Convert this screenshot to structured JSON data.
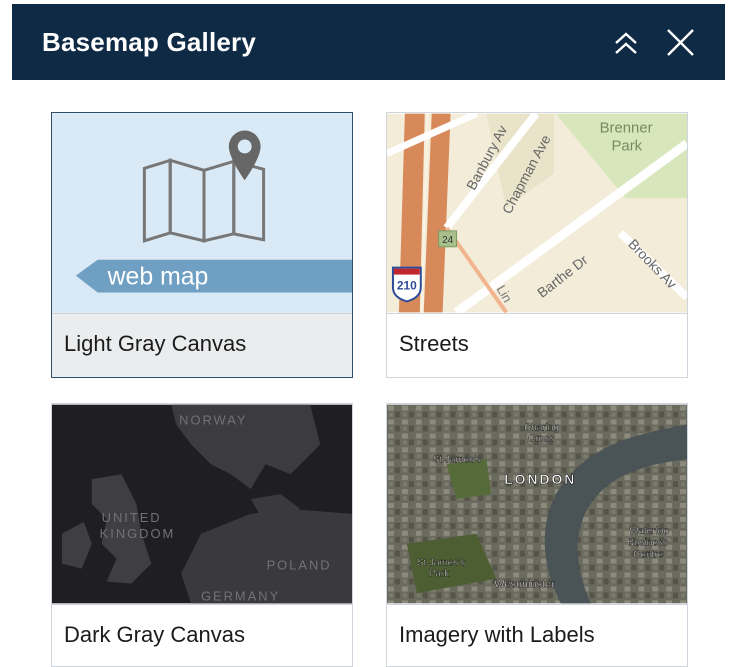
{
  "header": {
    "title": "Basemap Gallery",
    "collapse_icon": "double-chevron-up-icon",
    "close_icon": "close-icon",
    "background": "#0e2a44"
  },
  "gallery": [
    {
      "label": "Light Gray Canvas",
      "selected": true,
      "thumbnail": {
        "kind": "web-map-placeholder",
        "icon": "folded-map-pin-icon",
        "banner_text": "web map",
        "background": "#d9e9f5",
        "banner_color": "#6f9fc3"
      }
    },
    {
      "label": "Streets",
      "selected": false,
      "thumbnail": {
        "kind": "streets",
        "labels": [
          "Banbury Av",
          "Chapman Ave",
          "Brenner",
          "Park",
          "24",
          "210",
          "Barthe Dr",
          "Brooks Av",
          "Lin"
        ]
      }
    },
    {
      "label": "Dark Gray Canvas",
      "selected": false,
      "thumbnail": {
        "kind": "dark-gray-canvas",
        "labels": [
          "NORWAY",
          "UNITED",
          "KINGDOM",
          "POLAND",
          "GERMANY"
        ]
      }
    },
    {
      "label": "Imagery with Labels",
      "selected": false,
      "thumbnail": {
        "kind": "imagery",
        "labels": [
          "Charing",
          "Cross",
          "St James's",
          "LONDON",
          "Waterloo",
          "Business",
          "Centre",
          "St James's",
          "Park",
          "Westminster"
        ]
      }
    }
  ]
}
